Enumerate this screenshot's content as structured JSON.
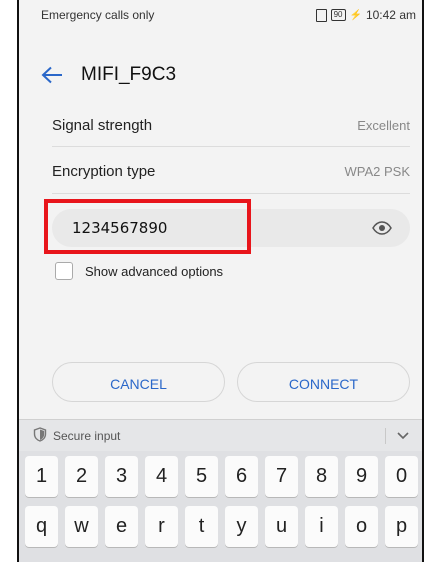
{
  "status_bar": {
    "carrier": "Emergency calls only",
    "battery": "90",
    "time": "10:42 am"
  },
  "header": {
    "title": "MIFI_F9C3"
  },
  "rows": [
    {
      "label": "Signal strength",
      "value": "Excellent"
    },
    {
      "label": "Encryption type",
      "value": "WPA2 PSK"
    }
  ],
  "password": {
    "value": "1234567890"
  },
  "advanced": {
    "label": "Show advanced options"
  },
  "buttons": {
    "cancel": "CANCEL",
    "connect": "CONNECT"
  },
  "keyboard": {
    "secure_label": "Secure input",
    "row1": [
      "1",
      "2",
      "3",
      "4",
      "5",
      "6",
      "7",
      "8",
      "9",
      "0"
    ],
    "row2": [
      "q",
      "w",
      "e",
      "r",
      "t",
      "y",
      "u",
      "i",
      "o",
      "p"
    ]
  },
  "colors": {
    "accent": "#2a67c9",
    "highlight": "#e8151b"
  }
}
